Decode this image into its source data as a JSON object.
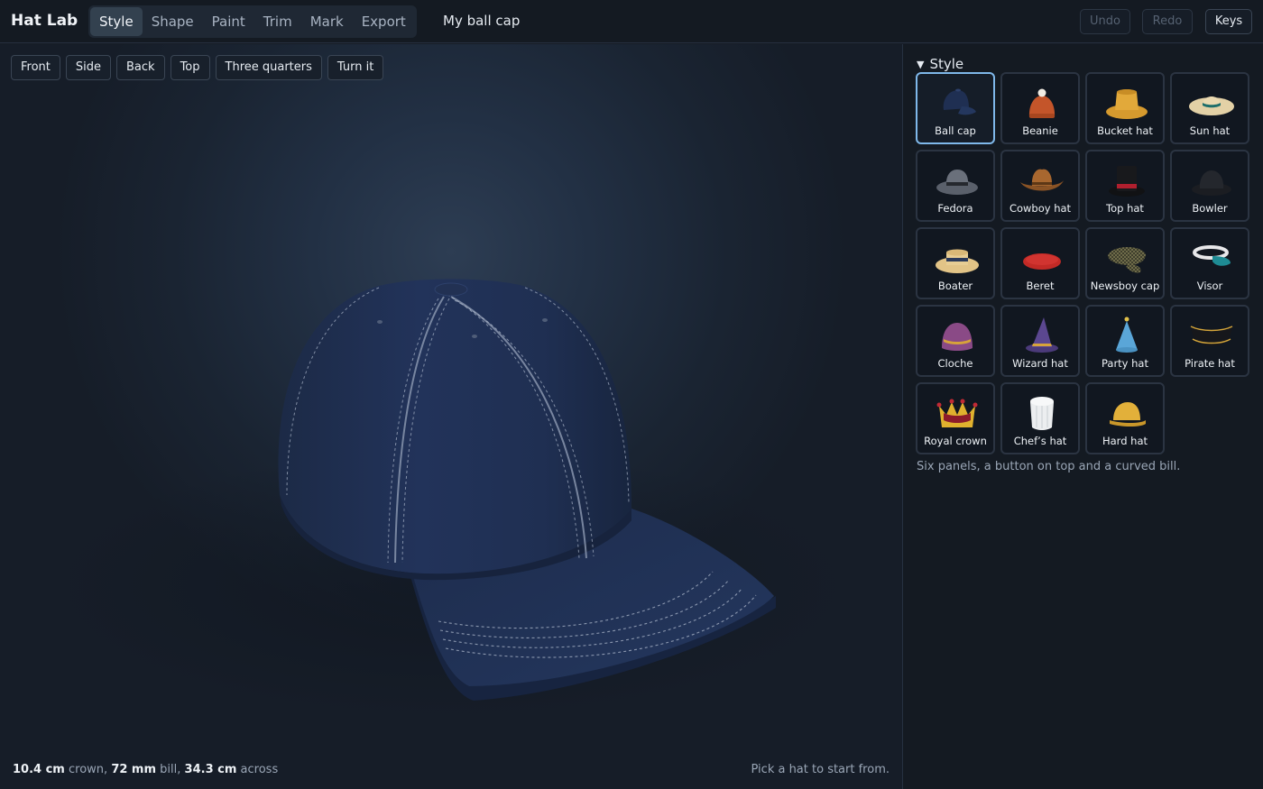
{
  "app": {
    "title": "Hat Lab",
    "document_name": "My ball cap"
  },
  "tabs": [
    {
      "label": "Style",
      "active": true
    },
    {
      "label": "Shape",
      "active": false
    },
    {
      "label": "Paint",
      "active": false
    },
    {
      "label": "Trim",
      "active": false
    },
    {
      "label": "Mark",
      "active": false
    },
    {
      "label": "Export",
      "active": false
    }
  ],
  "toolbar": {
    "undo": "Undo",
    "redo": "Redo",
    "keys": "Keys",
    "undo_enabled": false,
    "redo_enabled": false
  },
  "views": [
    "Front",
    "Side",
    "Back",
    "Top",
    "Three quarters",
    "Turn it"
  ],
  "measure": {
    "crown_value": "10.4 cm",
    "crown_label": "crown,",
    "bill_value": "72 mm",
    "bill_label": "bill,",
    "across_value": "34.3 cm",
    "across_label": "across"
  },
  "hint": "Pick a hat to start from.",
  "panel": {
    "section_title": "Style",
    "hats": [
      {
        "label": "Ball cap",
        "icon": "ball-cap-icon",
        "selected": true
      },
      {
        "label": "Beanie",
        "icon": "beanie-icon"
      },
      {
        "label": "Bucket hat",
        "icon": "bucket-hat-icon"
      },
      {
        "label": "Sun hat",
        "icon": "sun-hat-icon"
      },
      {
        "label": "Fedora",
        "icon": "fedora-icon"
      },
      {
        "label": "Cowboy hat",
        "icon": "cowboy-hat-icon"
      },
      {
        "label": "Top hat",
        "icon": "top-hat-icon"
      },
      {
        "label": "Bowler",
        "icon": "bowler-icon"
      },
      {
        "label": "Boater",
        "icon": "boater-icon"
      },
      {
        "label": "Beret",
        "icon": "beret-icon"
      },
      {
        "label": "Newsboy cap",
        "icon": "newsboy-cap-icon"
      },
      {
        "label": "Visor",
        "icon": "visor-icon"
      },
      {
        "label": "Cloche",
        "icon": "cloche-icon"
      },
      {
        "label": "Wizard hat",
        "icon": "wizard-hat-icon"
      },
      {
        "label": "Party hat",
        "icon": "party-hat-icon"
      },
      {
        "label": "Pirate hat",
        "icon": "pirate-hat-icon"
      },
      {
        "label": "Royal crown",
        "icon": "royal-crown-icon"
      },
      {
        "label": "Chef’s hat",
        "icon": "chefs-hat-icon"
      },
      {
        "label": "Hard hat",
        "icon": "hard-hat-icon"
      }
    ],
    "description": "Six panels, a button on top and a curved bill."
  },
  "colors": {
    "accent": "#7fb8ea",
    "cap": "#1f2f4f",
    "background": "#161c25"
  }
}
